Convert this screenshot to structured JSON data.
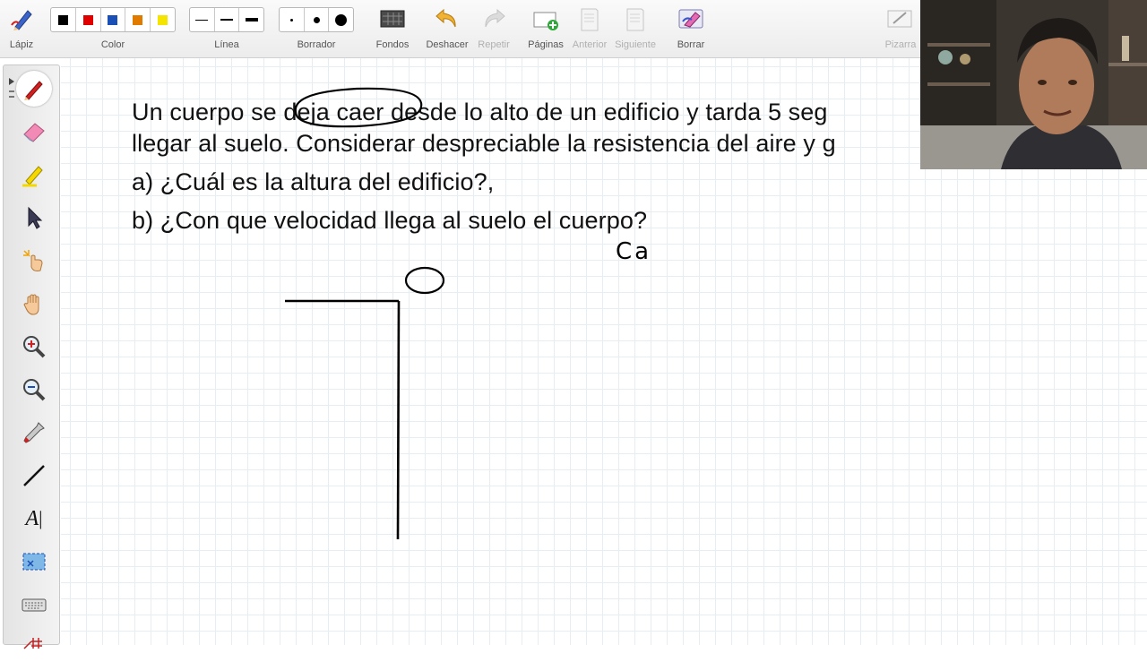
{
  "toolbar": {
    "pencil_label": "Lápiz",
    "color_label": "Color",
    "line_label": "Línea",
    "eraser_label": "Borrador",
    "backgrounds_label": "Fondos",
    "undo_label": "Deshacer",
    "redo_label": "Repetir",
    "pages_label": "Páginas",
    "previous_label": "Anterior",
    "next_label": "Siguiente",
    "clear_label": "Borrar",
    "board_label": "Pizarra",
    "colors": [
      "#000000",
      "#e00000",
      "#1a4fb5",
      "#e07b00",
      "#f5e400"
    ],
    "line_widths": [
      "thin",
      "medium",
      "thick"
    ],
    "eraser_sizes": [
      "small",
      "medium",
      "large"
    ]
  },
  "palette": {
    "tools": [
      "pencil-icon",
      "eraser-icon",
      "highlighter-icon",
      "pointer-icon",
      "laser-pointer-icon",
      "hand-pan-icon",
      "zoom-in-icon",
      "zoom-out-icon",
      "eyedropper-icon",
      "line-icon",
      "text-icon",
      "screenshot-icon",
      "keyboard-icon",
      "grid-icon"
    ],
    "text_tool_glyph": "A"
  },
  "board": {
    "problem": {
      "line1_pre": "Un cuerpo se ",
      "line1_circled": "deja caer",
      "line1_post": " desde lo alto de un edificio y tarda 5 seg",
      "line2": "llegar al suelo. Considerar despreciable la resistencia del aire y g",
      "question_a": "a) ¿Cuál es la altura del edificio?,",
      "question_b": "b) ¿Con que velocidad llega al suelo el cuerpo?"
    },
    "handwriting": "Ca"
  },
  "colors": {
    "grid": "#e6eef3",
    "ink": "#000000",
    "toolbar_bg": "#efefef"
  }
}
